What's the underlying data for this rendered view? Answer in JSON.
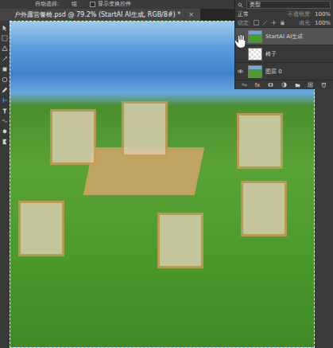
{
  "options_bar": {
    "items": [
      "自动选择:",
      "组",
      "显示变换控件"
    ]
  },
  "document_tab": {
    "title": "户外露营餐椅.psd @ 79.2% (StartAI AI生成, RGB/8#) *",
    "close": "×"
  },
  "layers_panel": {
    "filter": "类型",
    "blend_mode": "正常",
    "opacity_label": "不透明度:",
    "opacity": "100%",
    "lock_label": "锁定:",
    "fill_label": "填充:",
    "fill": "100%",
    "layers": [
      {
        "name": "StartAI AI生成",
        "selected": true,
        "visible": false
      },
      {
        "name": "椅子",
        "selected": false,
        "visible": false
      },
      {
        "name": "图层 0",
        "selected": false,
        "visible": true
      }
    ],
    "footer": [
      "fx"
    ]
  }
}
